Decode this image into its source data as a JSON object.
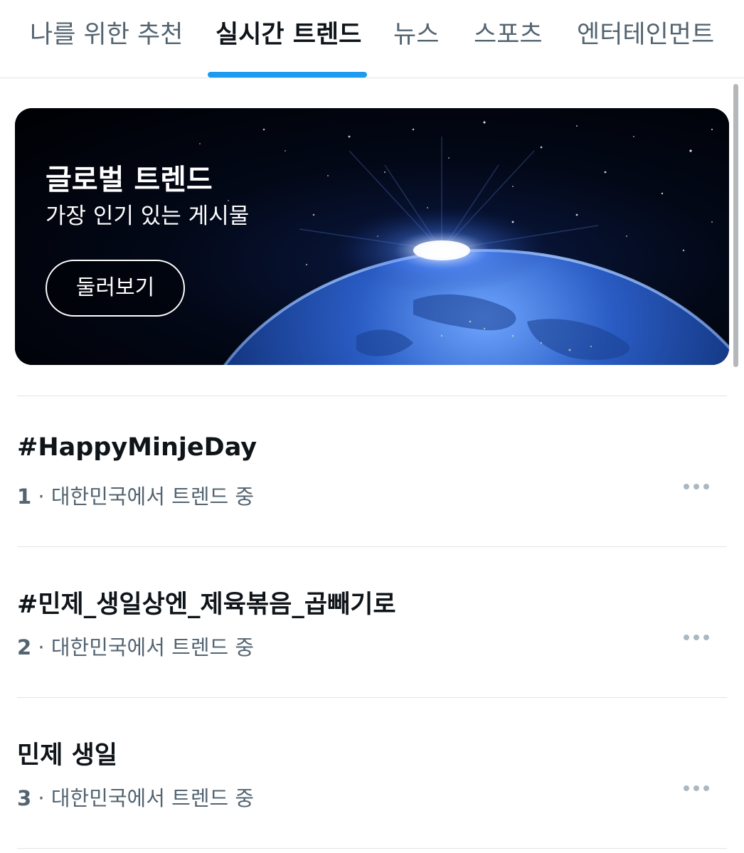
{
  "tabs": [
    {
      "label": "나를 위한 추천",
      "active": false
    },
    {
      "label": "실시간 트렌드",
      "active": true
    },
    {
      "label": "뉴스",
      "active": false
    },
    {
      "label": "스포츠",
      "active": false
    },
    {
      "label": "엔터테인먼트",
      "active": false
    }
  ],
  "banner": {
    "title": "글로벌 트렌드",
    "subtitle": "가장 인기 있는 게시물",
    "button_label": "둘러보기"
  },
  "trends": [
    {
      "rank": "1",
      "name": "#HappyMinjeDay",
      "context": " · 대한민국에서 트렌드 중"
    },
    {
      "rank": "2",
      "name": "#민제_생일상엔_제육볶음_곱빼기로",
      "context": " · 대한민국에서 트렌드 중"
    },
    {
      "rank": "3",
      "name": "민제 생일",
      "context": " · 대한민국에서 트렌드 중"
    }
  ],
  "icons": {
    "more": "more-horizontal-icon"
  },
  "colors": {
    "accent": "#1d9bf0",
    "text_primary": "#0f1419",
    "text_secondary": "#536471",
    "divider": "#e1e4e7"
  }
}
